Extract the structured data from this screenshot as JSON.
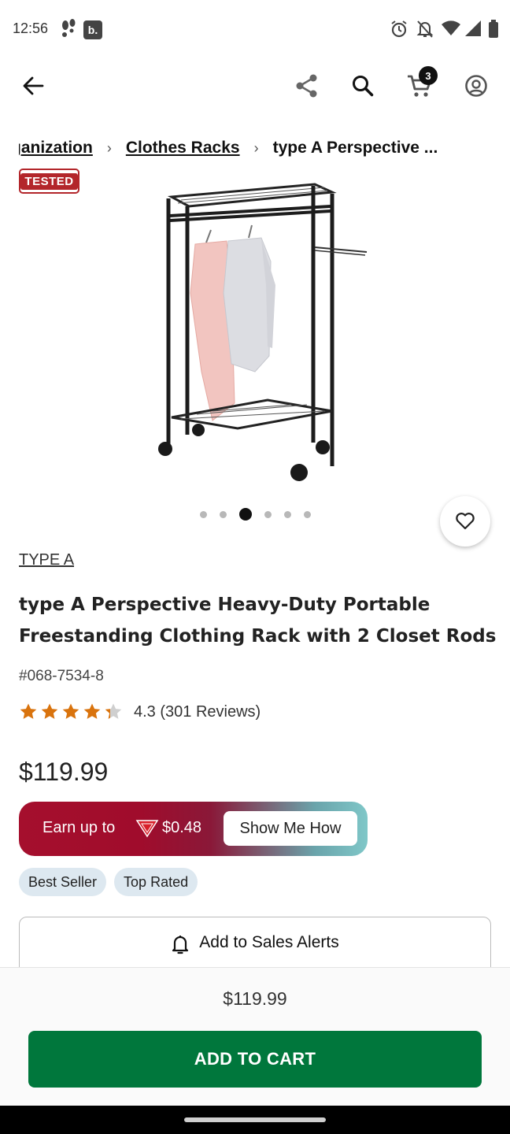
{
  "status_bar": {
    "time": "12:56",
    "left_icons": [
      "footsteps-icon",
      "app-b-icon"
    ],
    "right_icons": [
      "alarm-icon",
      "bell-off-icon",
      "wifi-icon",
      "signal-icon",
      "battery-icon"
    ],
    "app_b_label": "b."
  },
  "app_bar": {
    "cart_count": "3"
  },
  "breadcrumb": {
    "items": [
      {
        "label": "ganization"
      },
      {
        "label": "Clothes Racks"
      }
    ],
    "current": "type A Perspective ..."
  },
  "tested_badge": "TESTED",
  "carousel": {
    "count": 6,
    "active_index": 2
  },
  "product": {
    "brand": "TYPE A",
    "title": "type A Perspective Heavy-Duty Portable Freestanding Clothing Rack with 2 Closet Rods",
    "sku": "#068-7534-8",
    "rating_value": 4.3,
    "rating_text": "4.3 (301 Reviews)",
    "price": "$119.99"
  },
  "rewards": {
    "earn_label": "Earn up to",
    "amount": "$0.48",
    "cta": "Show Me How"
  },
  "badges": [
    "Best Seller",
    "Top Rated"
  ],
  "sales_alert": {
    "label": "Add to Sales Alerts"
  },
  "bottom_bar": {
    "price": "$119.99",
    "add_to_cart": "ADD TO CART",
    "button_color": "#00773c"
  },
  "colors": {
    "star": "#d9730d",
    "tested": "#b3262b",
    "badge_bg": "#dde8f0"
  }
}
